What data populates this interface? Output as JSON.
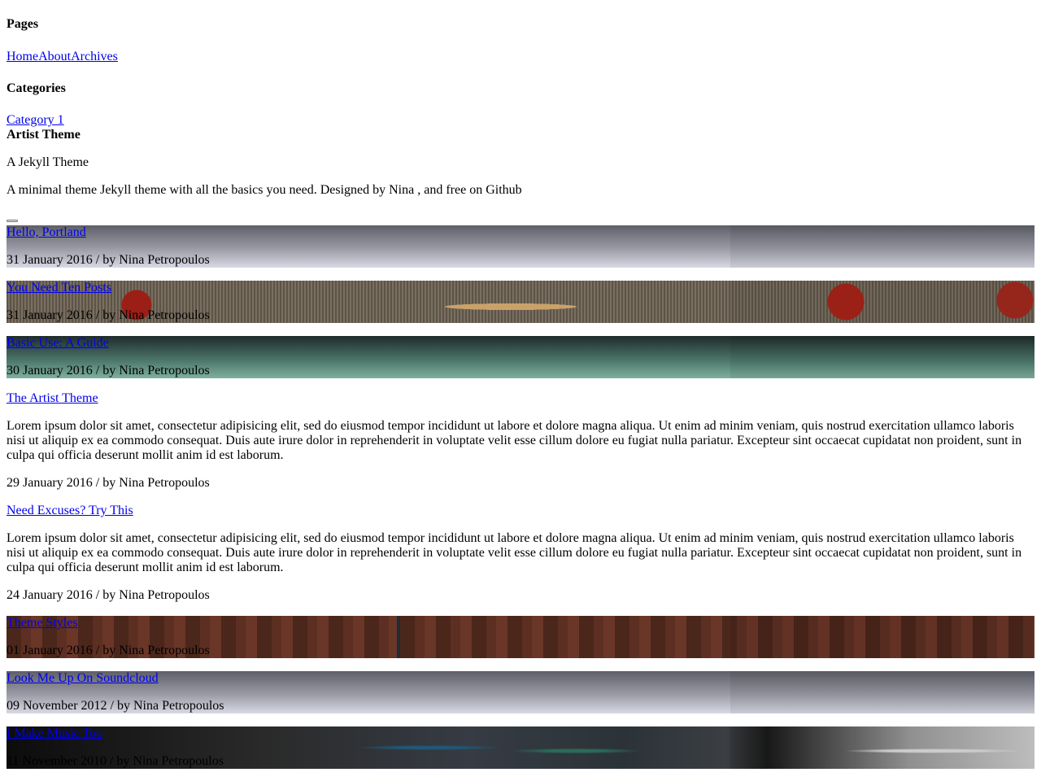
{
  "sidebar": {
    "pages_heading": "Pages",
    "pages": [
      "Home",
      "About",
      "Archives"
    ],
    "categories_heading": "Categories",
    "categories": [
      "Category 1"
    ]
  },
  "site": {
    "title": "Artist Theme",
    "subtitle": "A Jekyll Theme",
    "description": "A minimal theme Jekyll theme with all the basics you need. Designed by Nina , and free on Github"
  },
  "posts": [
    {
      "title": "Hello, Portland",
      "meta": "31 January 2016 / by Nina Petropoulos",
      "image": "grey-gradient"
    },
    {
      "title": "You Need Ten Posts",
      "meta": "31 January 2016 / by Nina Petropoulos",
      "image": "burlap-tomatoes"
    },
    {
      "title": "Basic Use: A Guide",
      "meta": "30 January 2016 / by Nina Petropoulos",
      "image": "teal-gradient"
    },
    {
      "title": "The Artist Theme",
      "excerpt": "Lorem ipsum dolor sit amet, consectetur adipisicing elit, sed do eiusmod tempor incididunt ut labore et dolore magna aliqua. Ut enim ad minim veniam, quis nostrud exercitation ullamco laboris nisi ut aliquip ex ea commodo consequat. Duis aute irure dolor in reprehenderit in voluptate velit esse cillum dolore eu fugiat nulla pariatur. Excepteur sint occaecat cupidatat non proident, sunt in culpa qui officia deserunt mollit anim id est laborum.",
      "meta": "29 January 2016 / by Nina Petropoulos"
    },
    {
      "title": "Need Excuses? Try This",
      "excerpt": "Lorem ipsum dolor sit amet, consectetur adipisicing elit, sed do eiusmod tempor incididunt ut labore et dolore magna aliqua. Ut enim ad minim veniam, quis nostrud exercitation ullamco laboris nisi ut aliquip ex ea commodo consequat. Duis aute irure dolor in reprehenderit in voluptate velit esse cillum dolore eu fugiat nulla pariatur. Excepteur sint occaecat cupidatat non proident, sunt in culpa qui officia deserunt mollit anim id est laborum.",
      "meta": "24 January 2016 / by Nina Petropoulos"
    },
    {
      "title": "Theme Styles",
      "meta": "01 January 2016 / by Nina Petropoulos",
      "image": "wood-desk"
    },
    {
      "title": "Look Me Up On Soundcloud",
      "meta": "09 November 2012 / by Nina Petropoulos",
      "image": "grey-gradient"
    },
    {
      "title": "I Make Music Too",
      "meta": "11 November 2010 / by Nina Petropoulos",
      "image": "blurred-shelf"
    }
  ],
  "colors": {
    "link": "#0000ee",
    "text": "#000000",
    "background": "#ffffff"
  }
}
